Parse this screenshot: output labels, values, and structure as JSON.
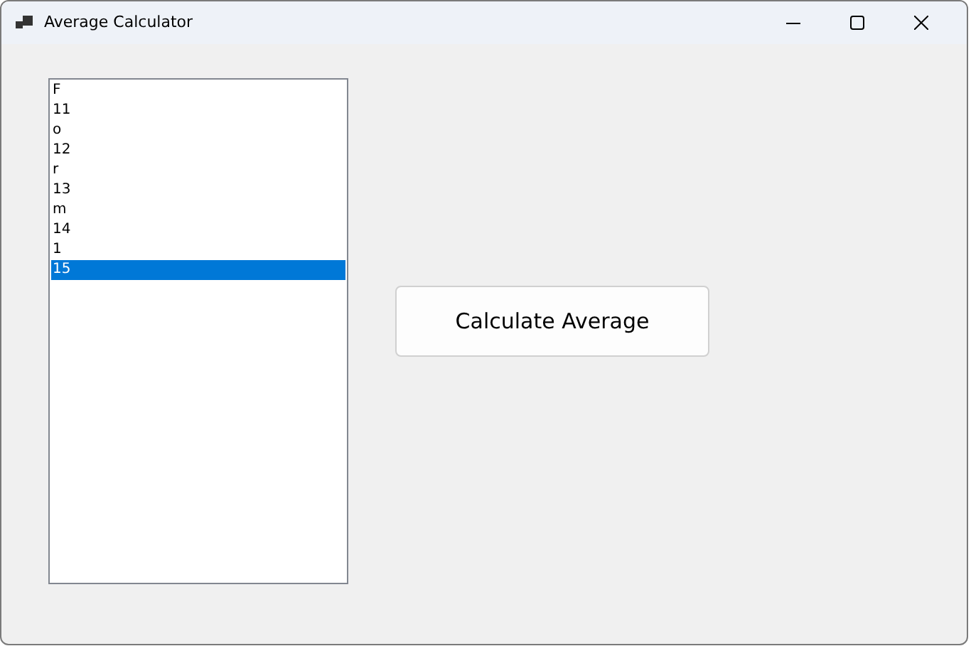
{
  "window": {
    "title": "Average Calculator"
  },
  "list": {
    "items": [
      {
        "text": "F",
        "selected": false
      },
      {
        "text": "11",
        "selected": false
      },
      {
        "text": "o",
        "selected": false
      },
      {
        "text": "12",
        "selected": false
      },
      {
        "text": "r",
        "selected": false
      },
      {
        "text": "13",
        "selected": false
      },
      {
        "text": "m",
        "selected": false
      },
      {
        "text": "14",
        "selected": false
      },
      {
        "text": "1",
        "selected": false
      },
      {
        "text": "15",
        "selected": true
      }
    ]
  },
  "buttons": [
    {
      "label": "Calculate Average"
    }
  ]
}
